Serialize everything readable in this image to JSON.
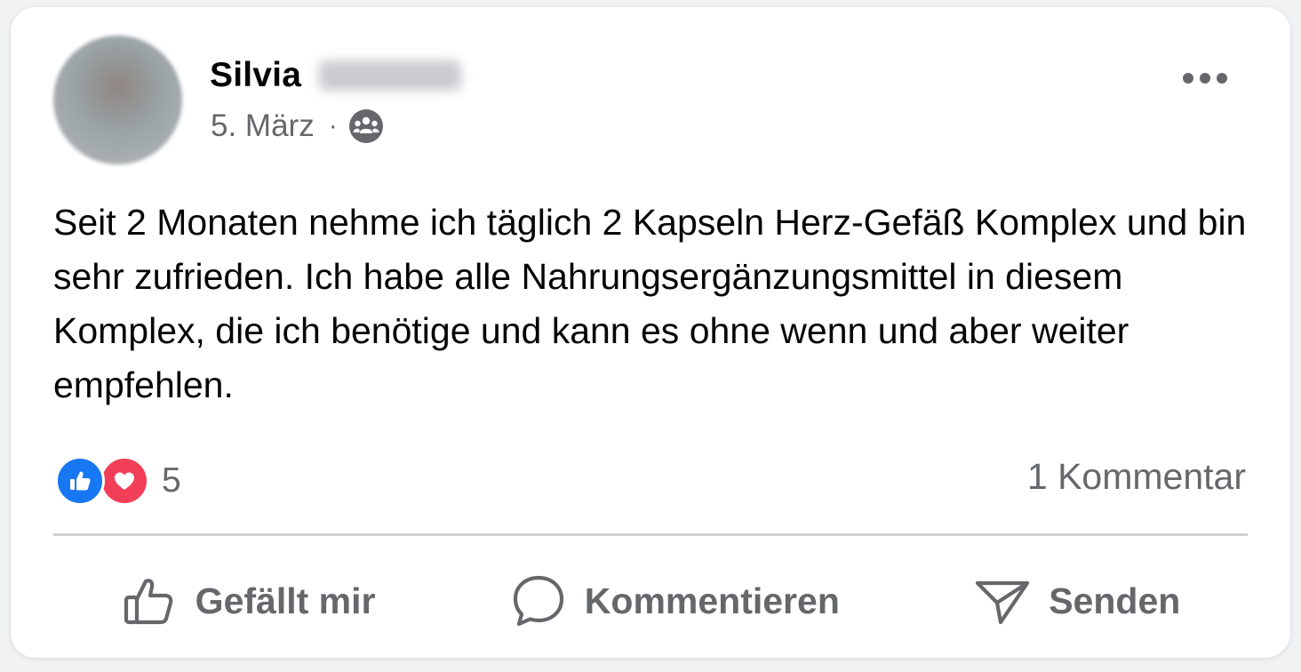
{
  "post": {
    "author_first_name": "Silvia",
    "date": "5. März",
    "separator": "·",
    "audience_icon": "group-icon",
    "more_icon": "more-dots-icon",
    "text": "Seit 2 Monaten nehme ich täglich 2 Kapseln Herz-Gefäß Komplex und bin sehr zufrieden. Ich habe alle Nahrungsergänzungsmittel in diesem Komplex, die ich benötige und kann es ohne wenn und aber weiter empfehlen."
  },
  "reactions": {
    "types": [
      "like-reaction-icon",
      "love-reaction-icon"
    ],
    "count": "5"
  },
  "comments": {
    "label": "1 Kommentar"
  },
  "actions": {
    "like_label": "Gefällt mir",
    "comment_label": "Kommentieren",
    "send_label": "Senden"
  },
  "colors": {
    "like_blue": "#1877f2",
    "love_red": "#f33e58",
    "secondary_text": "#65676b",
    "primary_text": "#050505"
  }
}
